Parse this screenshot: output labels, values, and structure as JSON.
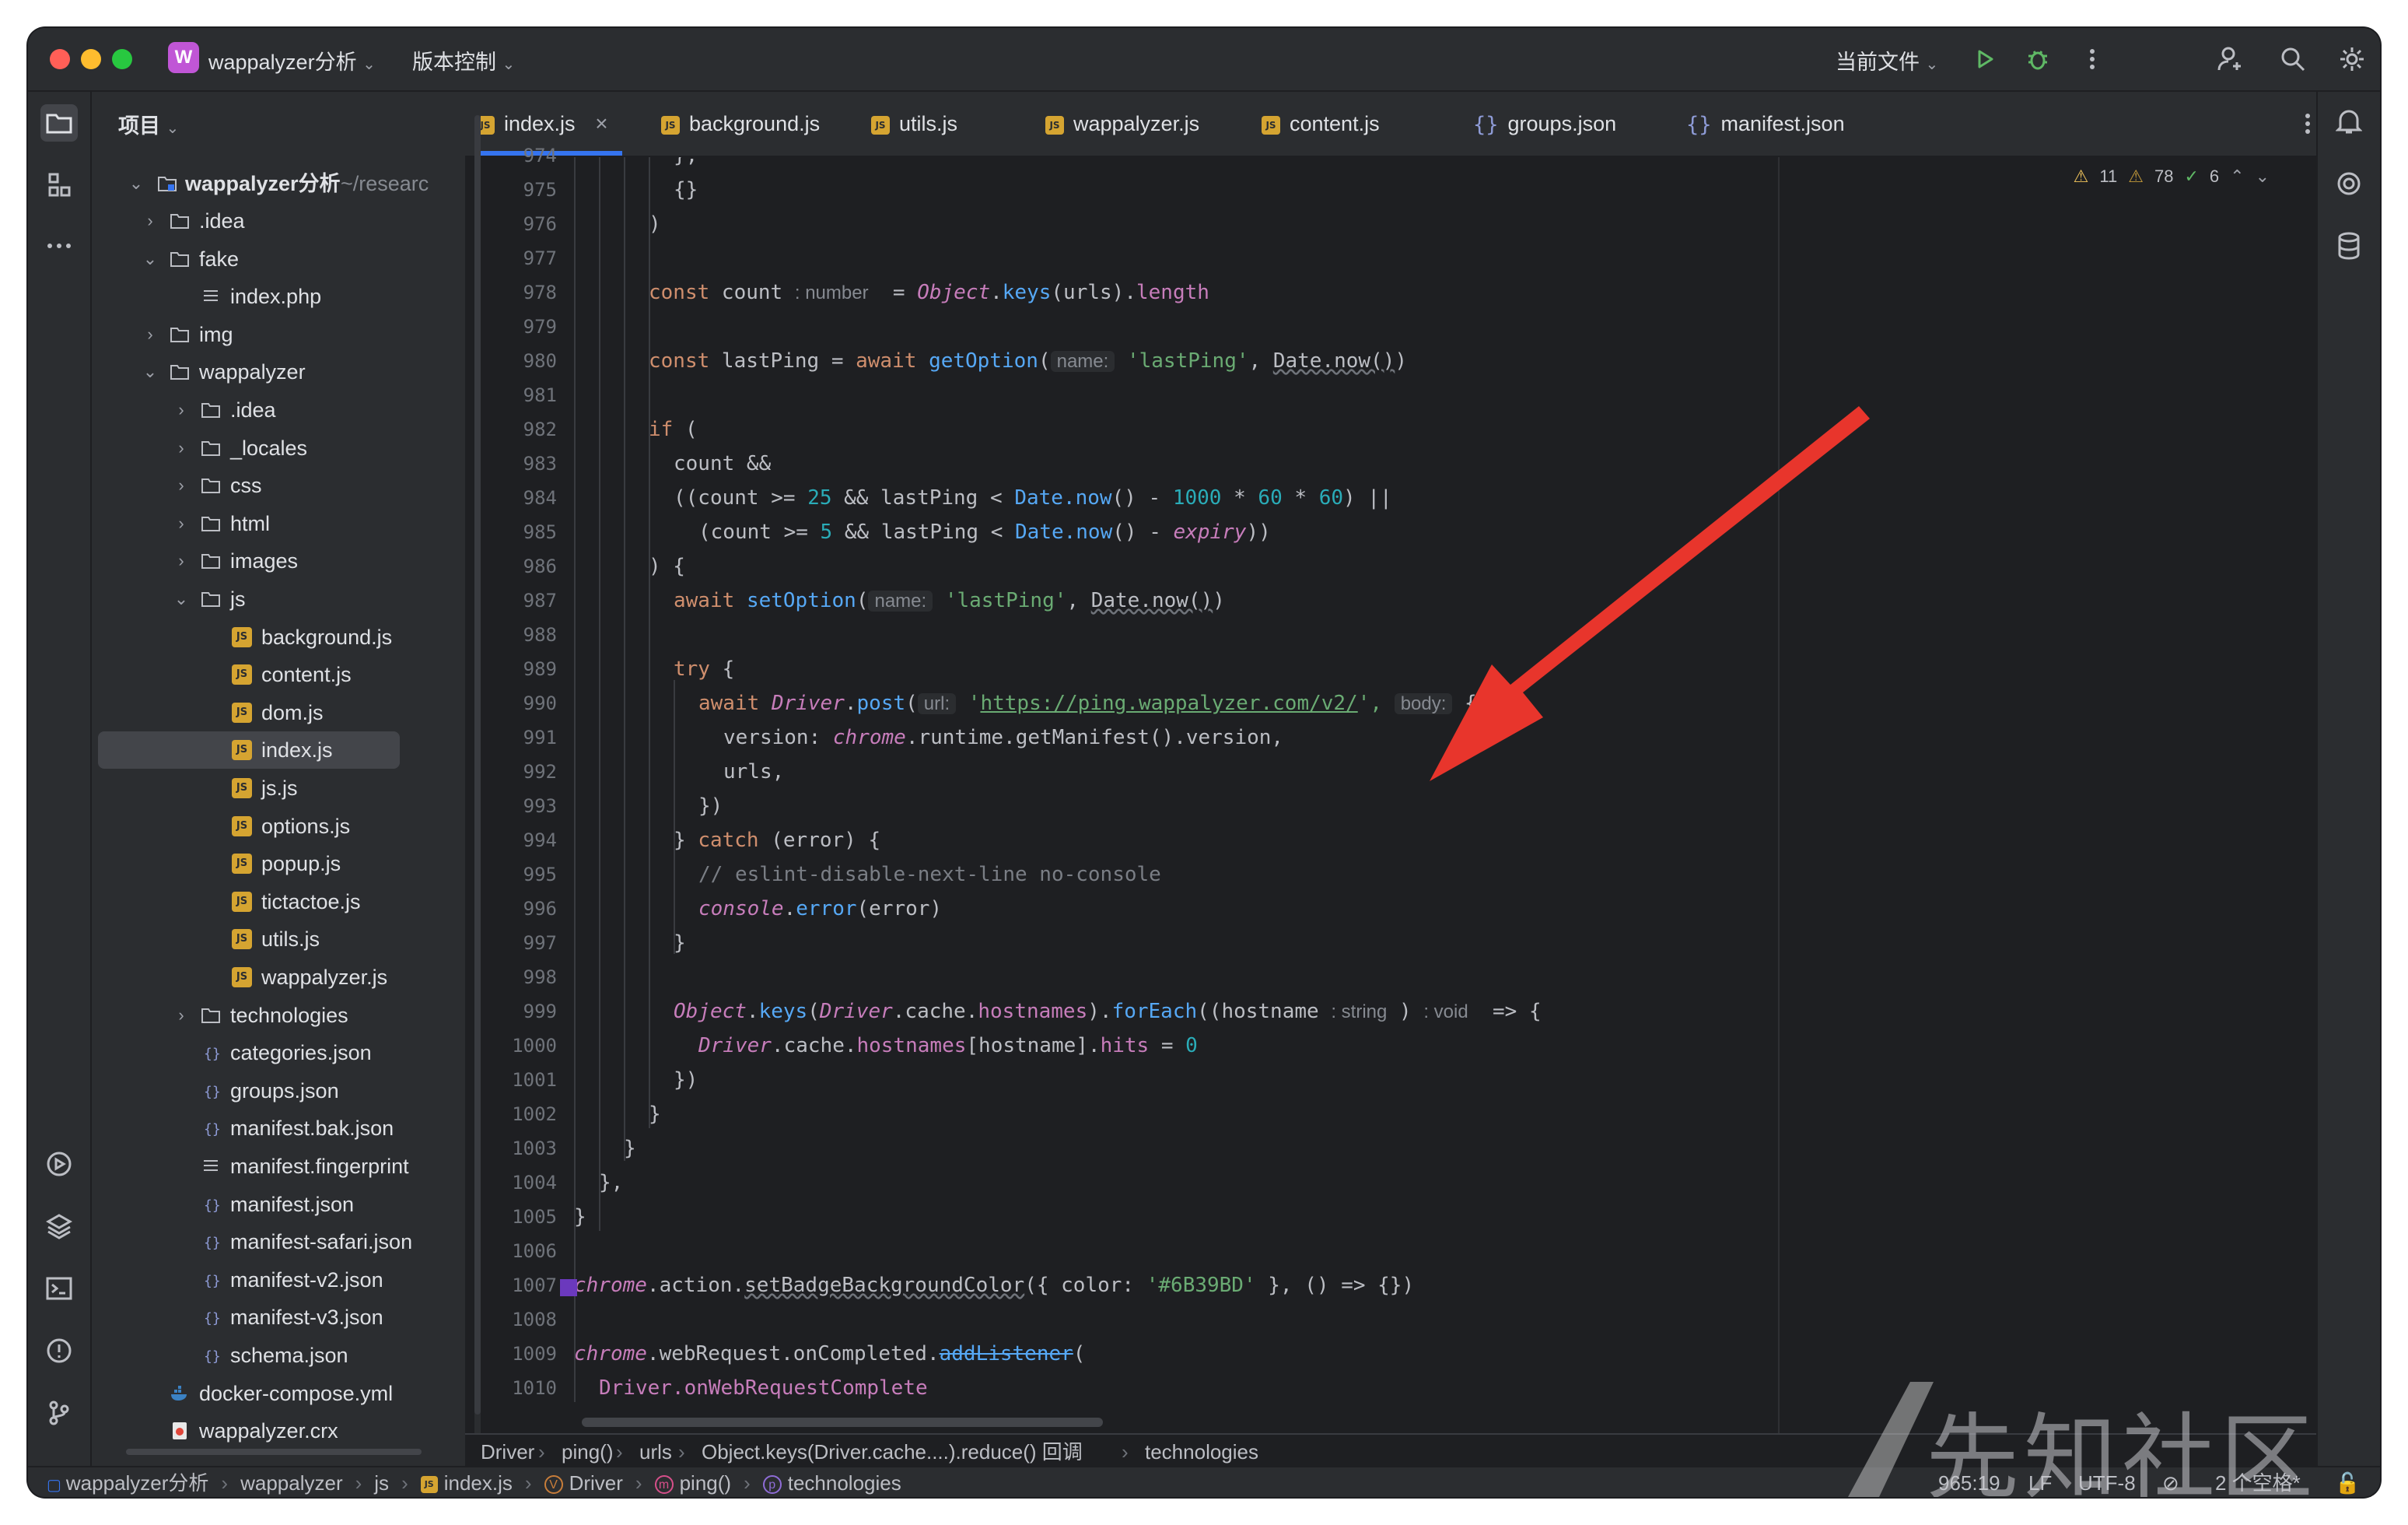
{
  "titlebar": {
    "project_badge": "W",
    "project_name": "wappalyzer分析",
    "vcs": "版本控制",
    "run_config": "当前文件"
  },
  "project_panel": {
    "title": "项目",
    "root_name": "wappalyzer分析",
    "root_path": "~/researc",
    "items": [
      {
        "label": ".idea",
        "type": "folder"
      },
      {
        "label": "fake",
        "type": "folder"
      },
      {
        "label": "index.php",
        "type": "file"
      },
      {
        "label": "img",
        "type": "folder"
      },
      {
        "label": "wappalyzer",
        "type": "folder"
      },
      {
        "label": ".idea",
        "type": "folder"
      },
      {
        "label": "_locales",
        "type": "folder"
      },
      {
        "label": "css",
        "type": "folder"
      },
      {
        "label": "html",
        "type": "folder"
      },
      {
        "label": "images",
        "type": "folder"
      },
      {
        "label": "js",
        "type": "folder"
      },
      {
        "label": "background.js",
        "type": "js"
      },
      {
        "label": "content.js",
        "type": "js"
      },
      {
        "label": "dom.js",
        "type": "js"
      },
      {
        "label": "index.js",
        "type": "js"
      },
      {
        "label": "js.js",
        "type": "js"
      },
      {
        "label": "options.js",
        "type": "js"
      },
      {
        "label": "popup.js",
        "type": "js"
      },
      {
        "label": "tictactoe.js",
        "type": "js"
      },
      {
        "label": "utils.js",
        "type": "js"
      },
      {
        "label": "wappalyzer.js",
        "type": "js"
      },
      {
        "label": "technologies",
        "type": "folder"
      },
      {
        "label": "categories.json",
        "type": "json"
      },
      {
        "label": "groups.json",
        "type": "json"
      },
      {
        "label": "manifest.bak.json",
        "type": "json"
      },
      {
        "label": "manifest.fingerprint",
        "type": "text"
      },
      {
        "label": "manifest.json",
        "type": "json"
      },
      {
        "label": "manifest-safari.json",
        "type": "json"
      },
      {
        "label": "manifest-v2.json",
        "type": "json"
      },
      {
        "label": "manifest-v3.json",
        "type": "json"
      },
      {
        "label": "schema.json",
        "type": "json"
      },
      {
        "label": "docker-compose.yml",
        "type": "docker"
      },
      {
        "label": "wappalyzer.crx",
        "type": "crx"
      }
    ]
  },
  "tabs": [
    {
      "label": "index.js",
      "icon": "js",
      "active": true
    },
    {
      "label": "background.js",
      "icon": "js"
    },
    {
      "label": "utils.js",
      "icon": "js"
    },
    {
      "label": "wappalyzer.js",
      "icon": "js"
    },
    {
      "label": "content.js",
      "icon": "js"
    },
    {
      "label": "groups.json",
      "icon": "json"
    },
    {
      "label": "manifest.json",
      "icon": "json"
    }
  ],
  "inspections": {
    "errors": "11",
    "warnings": "78",
    "ok": "6"
  },
  "line_numbers": [
    "974",
    "975",
    "976",
    "977",
    "978",
    "979",
    "980",
    "981",
    "982",
    "983",
    "984",
    "985",
    "986",
    "987",
    "988",
    "989",
    "990",
    "991",
    "992",
    "993",
    "994",
    "995",
    "996",
    "997",
    "998",
    "999",
    "1000",
    "1001",
    "1002",
    "1003",
    "1004",
    "1005",
    "1006",
    "1007",
    "1008",
    "1009",
    "1010"
  ],
  "code": {
    "l974": "},",
    "l975": "{}",
    "l976": ")",
    "l978_kw": "const",
    "l978_a": " count ",
    "l978_hint": ": number",
    "l978_b": "  = ",
    "l978_cls": "Object",
    "l978_c": ".",
    "l978_fn": "keys",
    "l978_d": "(urls).",
    "l978_prop": "length",
    "l980_kw": "const",
    "l980_a": " lastPing = ",
    "l980_kw2": "await",
    "l980_b": " ",
    "l980_fn": "getOption",
    "l980_c": "(",
    "l980_hint": "name:",
    "l980_str": " 'lastPing'",
    "l980_d": ", ",
    "l980_e": "Date.now()",
    "l980_f": ")",
    "l982_kw": "if",
    "l982_a": " (",
    "l983": "count &&",
    "l984_a": "((count >= ",
    "l984_n1": "25",
    "l984_b": " && lastPing < ",
    "l984_fn": "Date.now",
    "l984_c": "() - ",
    "l984_n2": "1000",
    "l984_d": " * ",
    "l984_n3": "60",
    "l984_e": " * ",
    "l984_n4": "60",
    "l984_f": ") ||",
    "l985_a": "(count >= ",
    "l985_n1": "5",
    "l985_b": " && lastPing < ",
    "l985_fn": "Date.now",
    "l985_c": "() - ",
    "l985_v": "expiry",
    "l985_d": "))",
    "l986": ") {",
    "l987_kw": "await",
    "l987_a": " ",
    "l987_fn": "setOption",
    "l987_b": "(",
    "l987_hint": "name:",
    "l987_str": " 'lastPing'",
    "l987_c": ", ",
    "l987_d": "Date.now()",
    "l987_e": ")",
    "l989_kw": "try",
    "l989_a": " {",
    "l990_kw": "await",
    "l990_a": " ",
    "l990_cls": "Driver",
    "l990_b": ".",
    "l990_fn": "post",
    "l990_c": "(",
    "l990_hint": "url:",
    "l990_d": " '",
    "l990_url": "https://ping.wappalyzer.com/v2/",
    "l990_e": "', ",
    "l990_hint2": "body:",
    "l990_f": " {",
    "l991_a": "version: ",
    "l991_cls": "chrome",
    "l991_b": ".runtime.",
    "l991_fn": "getManifest",
    "l991_c": "().version,",
    "l992": "urls,",
    "l993": "})",
    "l994_a": "} ",
    "l994_kw": "catch",
    "l994_b": " (error) {",
    "l995": "// eslint-disable-next-line no-console",
    "l996_cls": "console",
    "l996_a": ".",
    "l996_fn": "error",
    "l996_b": "(error)",
    "l997": "}",
    "l999_cls": "Object",
    "l999_a": ".",
    "l999_fn": "keys",
    "l999_b": "(",
    "l999_cls2": "Driver",
    "l999_c": ".cache.",
    "l999_prop": "hostnames",
    "l999_d": ").",
    "l999_fn2": "forEach",
    "l999_e": "((hostname ",
    "l999_hint": ": string",
    "l999_f": " ) ",
    "l999_hint2": ": void",
    "l999_g": "  => {",
    "l1000_cls": "Driver",
    "l1000_a": ".cache.",
    "l1000_prop": "hostnames",
    "l1000_b": "[hostname].",
    "l1000_prop2": "hits",
    "l1000_c": " = ",
    "l1000_n": "0",
    "l1001": "})",
    "l1002": "}",
    "l1003": "}",
    "l1004": "},",
    "l1005": "}",
    "l1007_cls": "chrome",
    "l1007_a": ".action.",
    "l1007_fn": "setBadgeBackgroundColor",
    "l1007_b": "({ color: ",
    "l1007_str": "'#6B39BD'",
    "l1007_c": " }, () => {})",
    "l1009_cls": "chrome",
    "l1009_a": ".webRequest.onCompleted.",
    "l1009_fn": "addListener",
    "l1009_b": "(",
    "l1010": "Driver.onWebRequestComplete"
  },
  "swatch_color": "#6B39BD",
  "breadcrumbs": [
    "Driver",
    "ping()",
    "urls",
    "Object.keys(Driver.cache....).reduce() 回调",
    "technologies"
  ],
  "status": {
    "path": [
      "wappalyzer分析",
      "wappalyzer",
      "js",
      "index.js",
      "Driver",
      "ping()",
      "technologies"
    ],
    "position": "965:19",
    "line_sep": "LF",
    "encoding": "UTF-8",
    "indent": "2 个空格*"
  },
  "watermark": "先知社区",
  "colors": {
    "accent": "#3574f0",
    "arrow": "#e8352c",
    "bg": "#1e1f22",
    "panel": "#2b2d30"
  }
}
